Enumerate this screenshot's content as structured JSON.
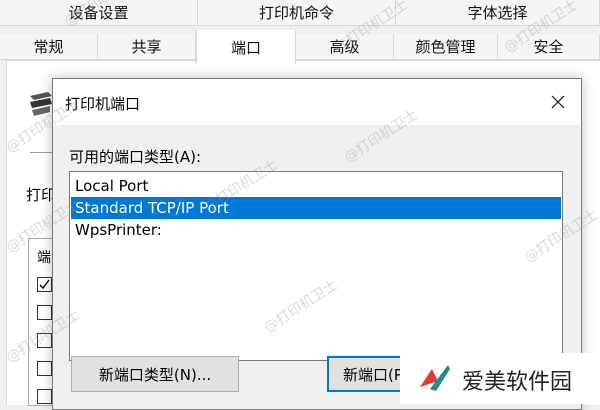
{
  "props_tabs_row1": [
    {
      "label": "设备设置"
    },
    {
      "label": "打印机命令"
    },
    {
      "label": "字体选择"
    }
  ],
  "props_tabs_row2": [
    {
      "label": "常规"
    },
    {
      "label": "共享"
    },
    {
      "label": "端口"
    },
    {
      "label": "高级"
    },
    {
      "label": "颜色管理"
    },
    {
      "label": "安全"
    }
  ],
  "props_page": {
    "partial_label": "打印",
    "list_header_partial": "端"
  },
  "dialog": {
    "title": "打印机端口",
    "list_label": "可用的端口类型(A):",
    "ports": [
      {
        "label": "Local Port",
        "selected": false
      },
      {
        "label": "Standard TCP/IP Port",
        "selected": true
      },
      {
        "label": "WpsPrinter:",
        "selected": false
      }
    ],
    "new_port_type_button": "新端口类型(N)...",
    "new_port_button": "新端口(P..."
  },
  "watermark_text": "@打印机卫士",
  "badge": {
    "text": "爱美软件园"
  },
  "colors": {
    "selection": "#0078d7",
    "badge_logo_red": "#e23a2e",
    "badge_logo_teal": "#1b8f8a"
  }
}
